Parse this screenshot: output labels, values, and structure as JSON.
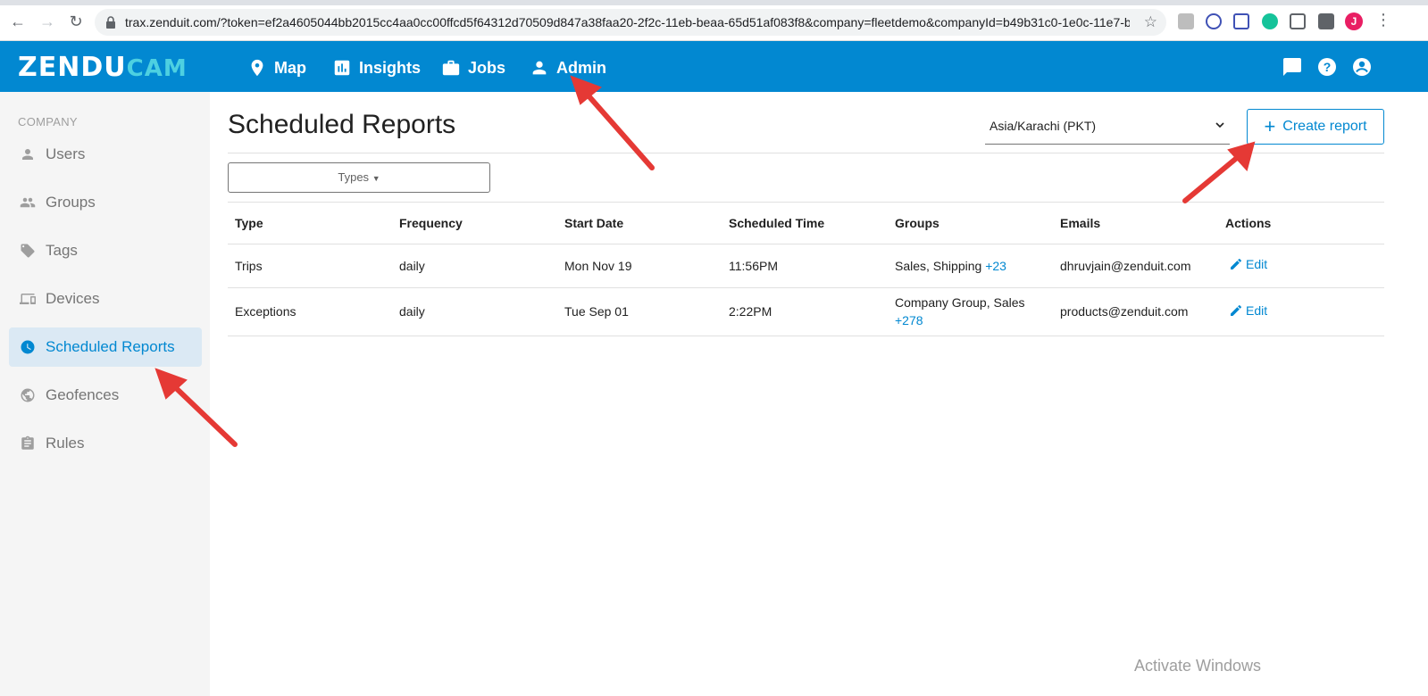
{
  "browser": {
    "url": "trax.zenduit.com/?token=ef2a4605044bb2015cc4aa0cc00ffcd5f64312d70509d847a38faa20-2f2c-11eb-beaa-65d51af083f8&company=fleetdemo&companyId=b49b31c0-1e0c-11e7-b3...",
    "profile_initial": "J"
  },
  "app": {
    "logo_main": "ZENDU",
    "logo_accent": "CAM",
    "nav": [
      {
        "label": "Map",
        "icon": "map-pin-icon"
      },
      {
        "label": "Insights",
        "icon": "bar-chart-icon"
      },
      {
        "label": "Jobs",
        "icon": "briefcase-icon"
      },
      {
        "label": "Admin",
        "icon": "person-icon"
      }
    ]
  },
  "sidebar": {
    "heading": "COMPANY",
    "items": [
      {
        "label": "Users",
        "icon": "person-icon"
      },
      {
        "label": "Groups",
        "icon": "group-icon"
      },
      {
        "label": "Tags",
        "icon": "tag-icon"
      },
      {
        "label": "Devices",
        "icon": "device-icon"
      },
      {
        "label": "Scheduled Reports",
        "icon": "clock-icon",
        "active": true
      },
      {
        "label": "Geofences",
        "icon": "globe-icon"
      },
      {
        "label": "Rules",
        "icon": "clipboard-icon"
      }
    ]
  },
  "main": {
    "title": "Scheduled Reports",
    "timezone": "Asia/Karachi (PKT)",
    "create_label": "Create report",
    "types_label": "Types",
    "table": {
      "headers": [
        "Type",
        "Frequency",
        "Start Date",
        "Scheduled Time",
        "Groups",
        "Emails",
        "Actions"
      ],
      "rows": [
        {
          "type": "Trips",
          "frequency": "daily",
          "start_date": "Mon Nov 19",
          "time": "11:56PM",
          "groups": "Sales, Shipping",
          "groups_more": "+23",
          "email": "dhruvjain@zenduit.com",
          "action": "Edit"
        },
        {
          "type": "Exceptions",
          "frequency": "daily",
          "start_date": "Tue Sep 01",
          "time": "2:22PM",
          "groups": "Company Group, Sales",
          "groups_more": "+278",
          "email": "products@zenduit.com",
          "action": "Edit"
        }
      ]
    }
  },
  "watermark": "Activate Windows",
  "colors": {
    "brand": "#0288d1",
    "accent": "#4dd0e1",
    "annotation": "#e53935"
  }
}
